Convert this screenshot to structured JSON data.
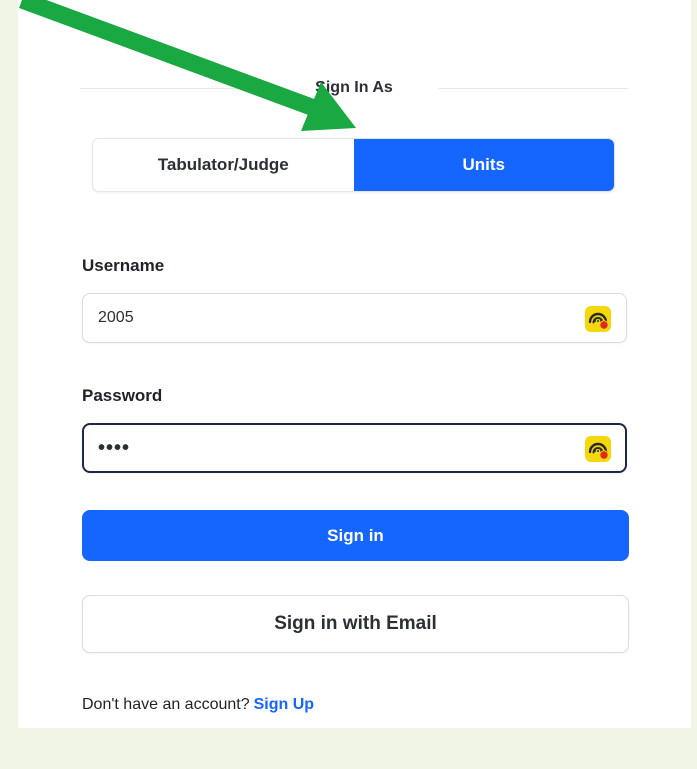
{
  "signin_header": {
    "title": "Sign In As"
  },
  "role_toggle": {
    "options": [
      "Tabulator/Judge",
      "Units"
    ],
    "selected": "Units"
  },
  "username": {
    "label": "Username",
    "value": "2005"
  },
  "password": {
    "label": "Password",
    "value": "••••"
  },
  "actions": {
    "sign_in": "Sign in",
    "sign_in_email": "Sign in with Email"
  },
  "footer": {
    "prompt": "Don't have an account?",
    "link": "Sign Up"
  },
  "icons": {
    "field_extension": "password-manager-extension-icon",
    "annotation": "green-arrow-annotation"
  },
  "colors": {
    "accent": "#1565ff",
    "annotation_arrow": "#1aa842",
    "page_background": "#f1f5e6",
    "extension_icon": "#f4d80b",
    "extension_dot": "#e02a1f"
  }
}
